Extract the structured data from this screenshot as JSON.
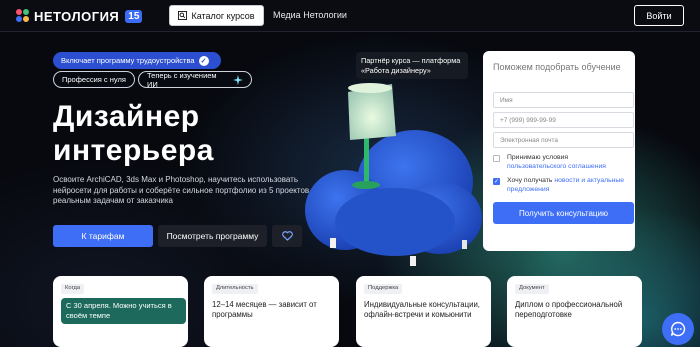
{
  "header": {
    "logo_text": "НЕТОЛОГИЯ",
    "logo_badge": "15",
    "catalog_label": "Каталог курсов",
    "media_label": "Медиа Нетологии",
    "login_label": "Войти"
  },
  "hero": {
    "badge_employment": "Включает программу трудоустройства",
    "badge_profession": "Профессия с нуля",
    "badge_ai": "Теперь с изучением ИИ",
    "title_line1": "Дизайнер",
    "title_line2": "интерьера",
    "description": "Освоите ArchiCAD, 3ds Max и Photoshop, научитесь использовать нейросети для работы и соберёте сильное портфолио из 5 проектов по реальным задачам от заказчика",
    "btn_tariff": "К тарифам",
    "btn_program": "Посмотреть программу",
    "partner_line1": "Партнёр курса — платформа",
    "partner_line2": "«Работа дизайнеру»"
  },
  "form": {
    "title": "Поможем подобрать обучение",
    "name_placeholder": "Имя",
    "phone_placeholder": "+7 (999) 999-99-99",
    "email_placeholder": "Электронная почта",
    "consent_text": "Принимаю условия",
    "consent_link": "пользовательского соглашения",
    "news_text": "Хочу получать",
    "news_link": "новости и актуальные предложения",
    "submit_label": "Получить консультацию"
  },
  "cards": [
    {
      "tag": "Когда",
      "text": "С 30 апреля. Можно учиться в своём темпе"
    },
    {
      "tag": "Длительность",
      "text": "12–14 месяцев — зависит от программы"
    },
    {
      "tag": "Поддержка",
      "text": "Индивидуальные консультации, офлайн-встречи и комьюнити"
    },
    {
      "tag": "Документ",
      "text": "Диплом о профессиональной переподготовке"
    }
  ],
  "colors": {
    "accent": "#3e6ef6",
    "badge_blue": "#2b4fd0",
    "card_green": "#1d6a5d",
    "chair": "#2a5ad8",
    "lamp_stand": "#2fb86b"
  },
  "icons": [
    "search-icon",
    "check-icon",
    "sparkle-icon",
    "heart-icon",
    "chat-icon"
  ]
}
